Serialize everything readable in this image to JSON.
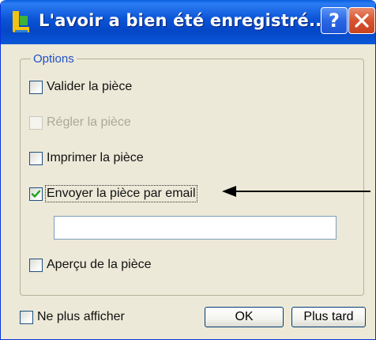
{
  "window": {
    "title": "L'avoir a bien été enregistré...",
    "help_label": "?",
    "close_label": "✕"
  },
  "options": {
    "group_label": "Options",
    "items": [
      {
        "label": "Valider la pièce",
        "checked": false,
        "enabled": true
      },
      {
        "label": "Régler la pièce",
        "checked": false,
        "enabled": false
      },
      {
        "label": "Imprimer la pièce",
        "checked": false,
        "enabled": true
      },
      {
        "label": "Envoyer la pièce par email",
        "checked": true,
        "enabled": true
      },
      {
        "label": "Aperçu de la pièce",
        "checked": false,
        "enabled": true
      }
    ],
    "email_value": ""
  },
  "footer": {
    "dont_show_label": "Ne plus afficher",
    "dont_show_checked": false,
    "ok_label": "OK",
    "later_label": "Plus tard"
  },
  "colors": {
    "title_bar": "#0a53d4",
    "group_label": "#2050c8",
    "check_mark": "#21a121"
  }
}
